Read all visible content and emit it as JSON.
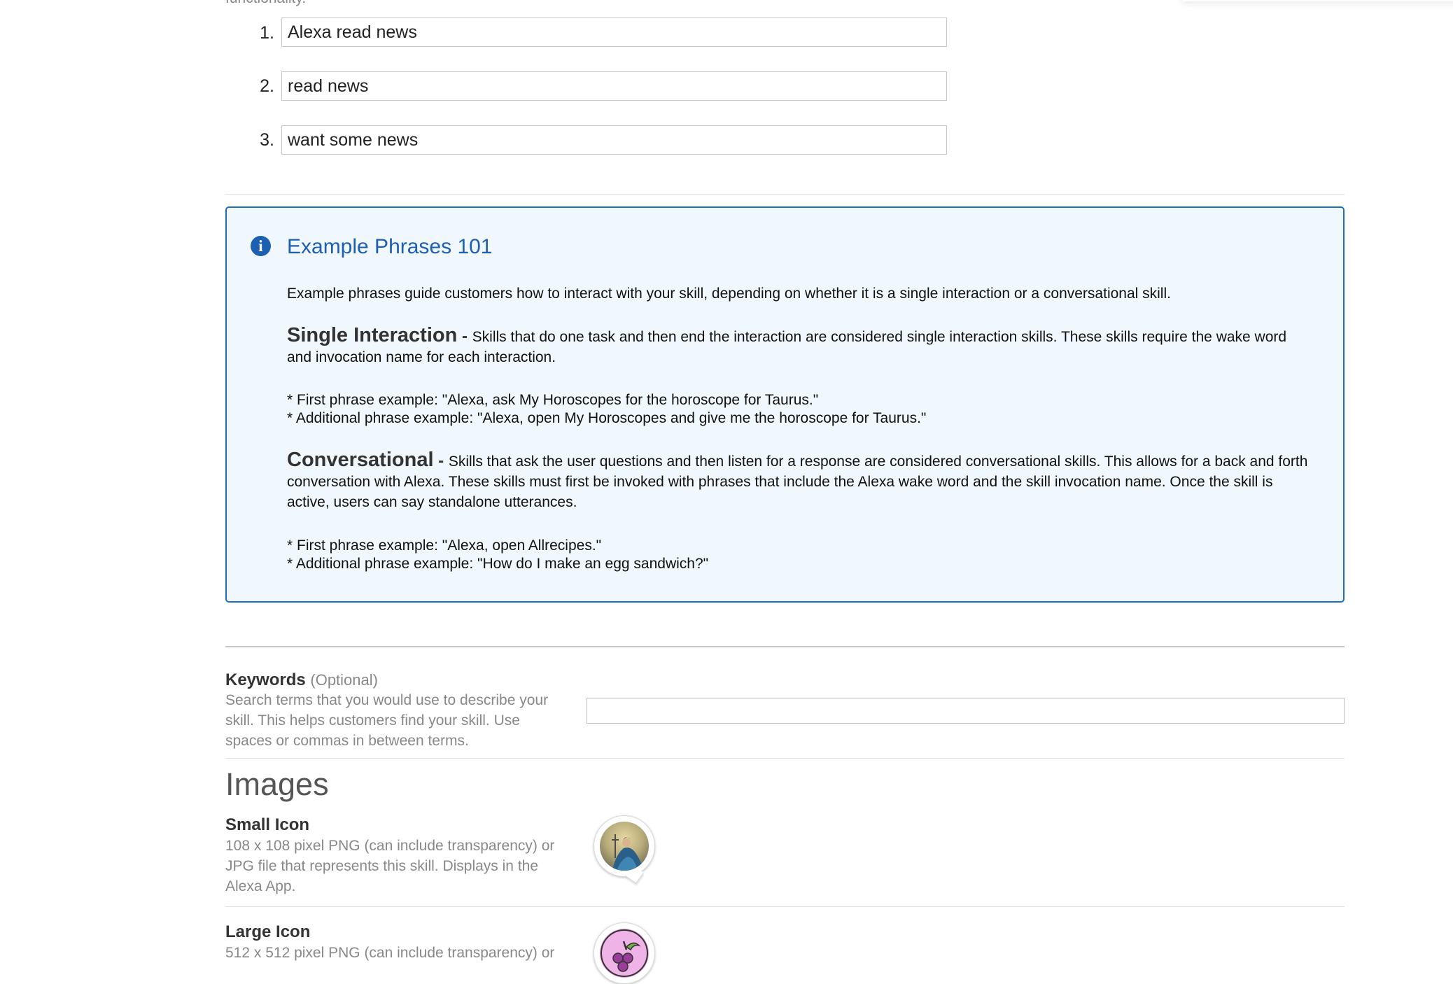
{
  "top_clip_text": "functionality.",
  "example_phrases": [
    {
      "num": "1.",
      "value": "Alexa read news"
    },
    {
      "num": "2.",
      "value": "read news"
    },
    {
      "num": "3.",
      "value": "want some news"
    }
  ],
  "info_box": {
    "title": "Example Phrases 101",
    "intro": "Example phrases guide customers how to interact with your skill, depending on whether it is a single interaction or a conversational skill.",
    "single": {
      "heading": "Single Interaction",
      "dash": " - ",
      "text": "Skills that do one task and then end the interaction are considered single interaction skills. These skills require the wake word and invocation name for each interaction.",
      "example1": "* First phrase example: \"Alexa, ask My Horoscopes for the horoscope for Taurus.\"",
      "example2": "* Additional phrase example: \"Alexa, open My Horoscopes and give me the horoscope for Taurus.\""
    },
    "conversational": {
      "heading": "Conversational",
      "dash": " - ",
      "text": "Skills that ask the user questions and then listen for a response are considered conversational skills. This allows for a back and forth conversation with Alexa. These skills must first be invoked with phrases that include the Alexa wake word and the skill invocation name. Once the skill is active, users can say standalone utterances.",
      "example1": "* First phrase example: \"Alexa, open Allrecipes.\"",
      "example2": "* Additional phrase example: \"How do I make an egg sandwich?\""
    }
  },
  "keywords": {
    "label": "Keywords",
    "optional": "(Optional)",
    "help": "Search terms that you would use to describe your skill. This helps customers find your skill. Use spaces or commas in between terms.",
    "value": ""
  },
  "images_section": {
    "title": "Images",
    "small_icon": {
      "label": "Small Icon",
      "help": "108 x 108 pixel PNG (can include transparency) or JPG file that represents this skill. Displays in the Alexa App."
    },
    "large_icon": {
      "label": "Large Icon",
      "help": "512 x 512 pixel PNG (can include transparency) or"
    }
  },
  "colors": {
    "accent": "#1d5fb0",
    "info_bg": "#f0f7fd",
    "muted": "#888888"
  }
}
